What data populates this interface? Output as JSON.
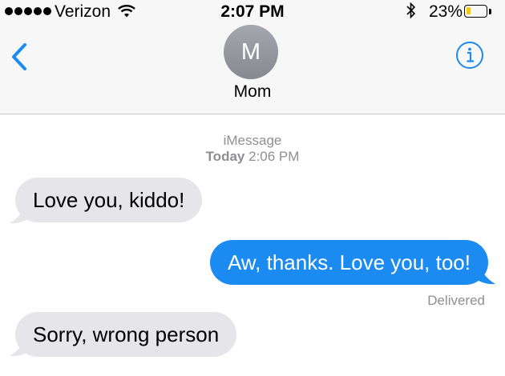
{
  "status_bar": {
    "carrier": "Verizon",
    "time": "2:07 PM",
    "battery_percent": "23%",
    "battery_level": 0.23,
    "signal_bars": 5,
    "icons": [
      "wifi-icon",
      "bluetooth-icon",
      "battery-icon"
    ]
  },
  "header": {
    "avatar_initial": "M",
    "contact_name": "Mom",
    "back_icon": "chevron-left-icon",
    "info_icon": "info-icon"
  },
  "conversation": {
    "service": "iMessage",
    "timestamp_day": "Today",
    "timestamp_time": "2:06 PM",
    "messages": [
      {
        "direction": "incoming",
        "text": "Love you, kiddo!"
      },
      {
        "direction": "outgoing",
        "text": "Aw, thanks. Love you, too!"
      },
      {
        "direction": "incoming",
        "text": "Sorry, wrong person"
      }
    ],
    "delivery_status": "Delivered"
  },
  "colors": {
    "accent": "#1b8bf2",
    "incoming_bubble": "#e5e5ea",
    "outgoing_bubble": "#1b8bf2",
    "meta_text": "#8e8e93",
    "battery_fill": "#f5c518"
  }
}
